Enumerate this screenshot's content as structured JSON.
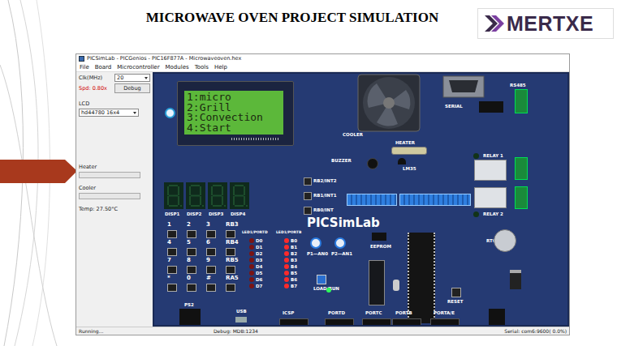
{
  "slide": {
    "title": "MICROWAVE OVEN PROJECT SIMULATION",
    "logo": "MERTXE"
  },
  "window": {
    "title": "PICSimLab - PICGenios - PIC16F877A - Microwaveoven.hex",
    "menu": [
      "File",
      "Board",
      "Microcontroller",
      "Modules",
      "Tools",
      "Help"
    ]
  },
  "left_panel": {
    "clock_label": "Clk(MHz)",
    "clock_value": "20",
    "speed": "Spd: 0.80x",
    "debug_button": "Debug",
    "lcd_label": "LCD",
    "lcd_value": "hd44780 16x4",
    "heater": {
      "label": "Heater",
      "level": 0
    },
    "cooler": {
      "label": "Cooler",
      "level": 0
    },
    "temp": "Temp: 27.50°C"
  },
  "board": {
    "lcd_lines": [
      "1:micro",
      "2:Grill",
      "3:Convection",
      "4:Start"
    ],
    "brand": "PICSimLab",
    "fan_label": "COOLER",
    "heater_label": "HEATER",
    "buzzer_label": "BUZZER",
    "sensor_label": "LM35",
    "serial_label": "SERIAL",
    "rs485_label": "RS485",
    "relays": [
      {
        "label": "RELAY 1",
        "on": false
      },
      {
        "label": "RELAY 2",
        "on": false
      }
    ],
    "int_buttons": [
      "RB2/INT2",
      "RB1/INT1",
      "RB0/INT"
    ],
    "displays": [
      {
        "label": "DISP1",
        "on": false
      },
      {
        "label": "DISP2",
        "on": false
      },
      {
        "label": "DISP3",
        "on": false
      },
      {
        "label": "DISP4",
        "on": false
      }
    ],
    "keypad": [
      "1",
      "2",
      "3",
      "RB3",
      "4",
      "5",
      "6",
      "RB4",
      "7",
      "8",
      "9",
      "RB5",
      "*",
      "0",
      "#",
      "RA5"
    ],
    "led_banks": [
      {
        "label": "LED1/PORTD",
        "leds": [
          {
            "label": "D0",
            "on": false
          },
          {
            "label": "D1",
            "on": false
          },
          {
            "label": "D2",
            "on": false
          },
          {
            "label": "D3",
            "on": false
          },
          {
            "label": "D4",
            "on": false
          },
          {
            "label": "D5",
            "on": false
          },
          {
            "label": "D6",
            "on": false
          },
          {
            "label": "D7",
            "on": false
          }
        ]
      },
      {
        "label": "LED1/PORTB",
        "leds": [
          {
            "label": "B0",
            "on": true
          },
          {
            "label": "B1",
            "on": true
          },
          {
            "label": "B2",
            "on": true
          },
          {
            "label": "B3",
            "on": true
          },
          {
            "label": "B4",
            "on": true
          },
          {
            "label": "B5",
            "on": true
          },
          {
            "label": "B6",
            "on": true
          },
          {
            "label": "B7",
            "on": true
          }
        ]
      }
    ],
    "pots": [
      "P1—AN0",
      "P2—AN1"
    ],
    "eeprom_label": "EEPROM",
    "rtc_label": "RTC",
    "load_run_label": "LOAD/RUN",
    "reset_label": "RESET",
    "power_led_on": true,
    "ps2_label": "PS2",
    "usb_label": "USB",
    "connectors": [
      "ICSP",
      "PORTD",
      "PORTC",
      "PORTB",
      "PORTA/E"
    ]
  },
  "status_bar": {
    "left": "Running...",
    "middle": "Debug: MDB:1234",
    "right": "Serial: com6:9600( 0.0%)"
  }
}
